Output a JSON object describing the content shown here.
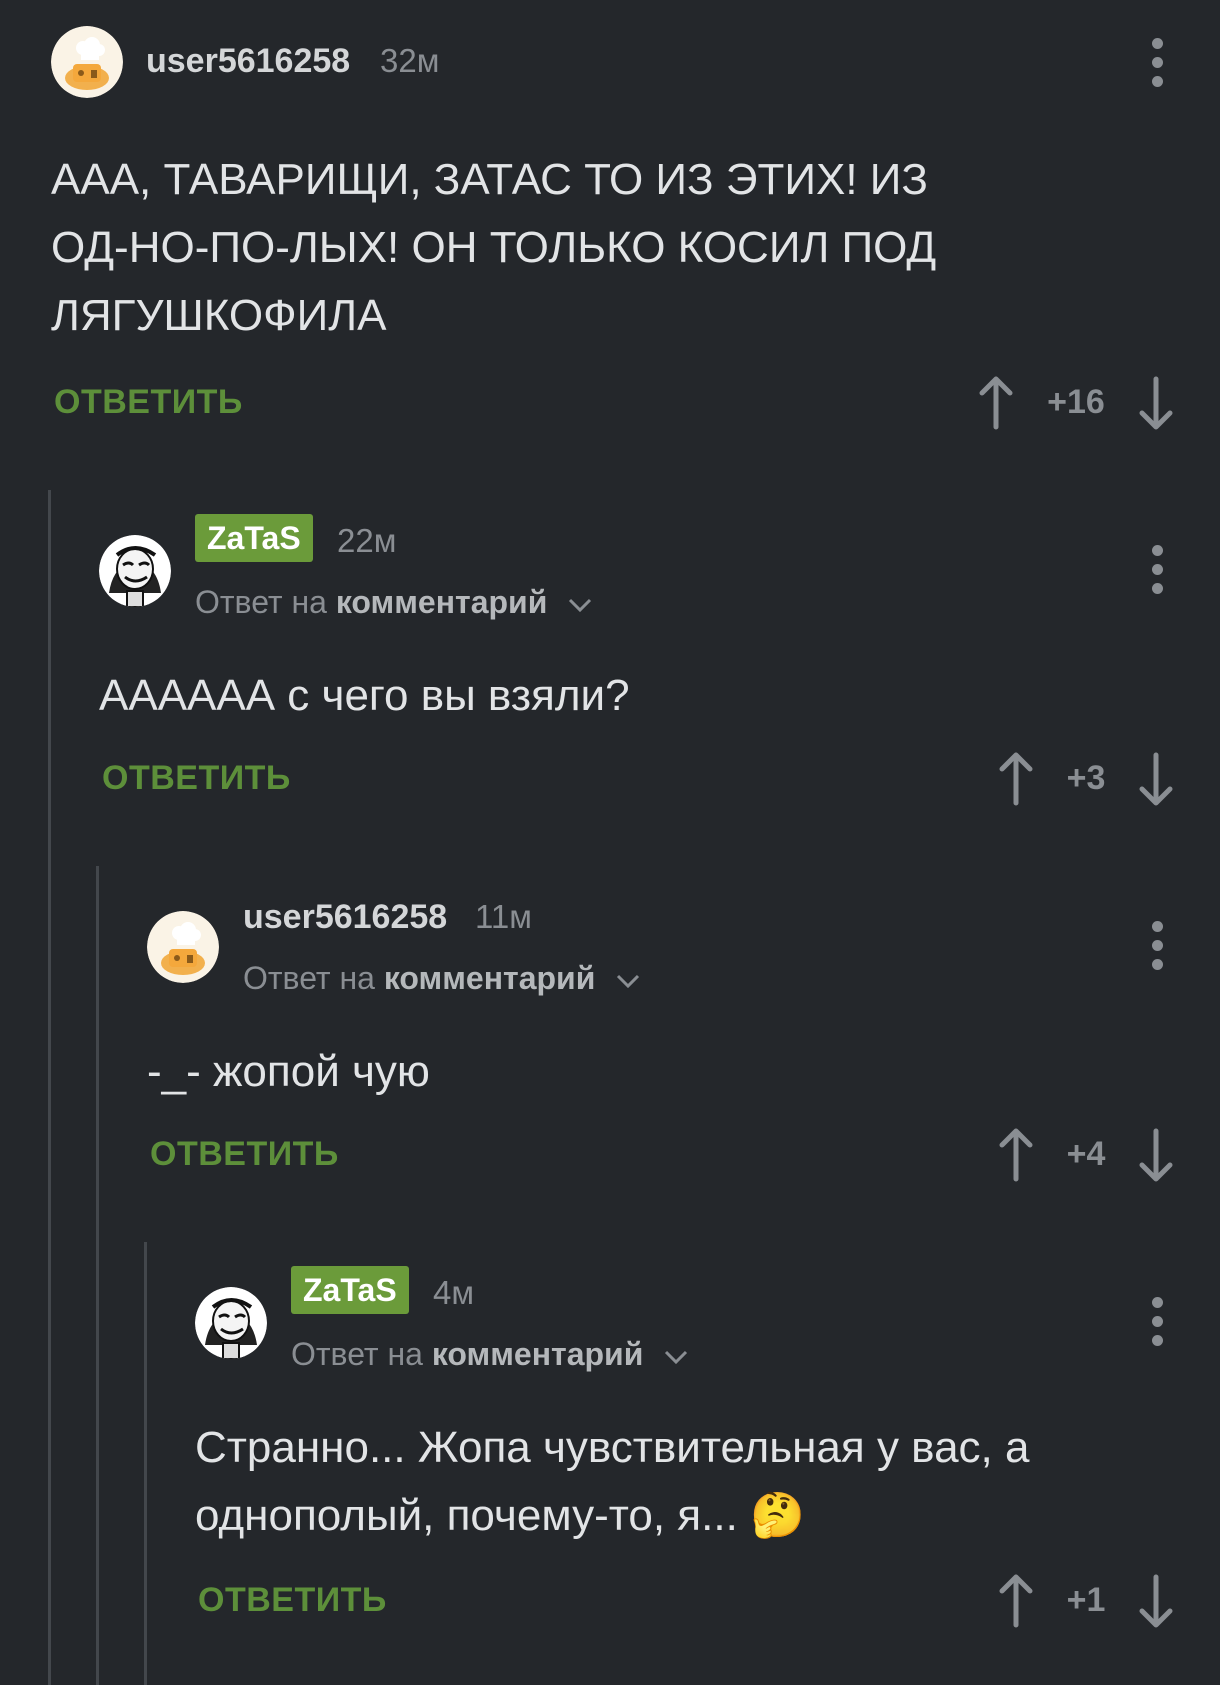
{
  "comments": [
    {
      "username": "user5616258",
      "time": "32м",
      "text": "ААА, ТАВАРИЩИ, ЗАТАС ТО ИЗ ЭТИХ! ИЗ\nОД-НО-ПО-ЛЫХ! ОН ТОЛЬКО КОСИЛ ПОД\nЛЯГУШКОФИЛА",
      "reply_label": "ОТВЕТИТЬ",
      "score": "+16"
    },
    {
      "username": "ZaTaS",
      "time": "22м",
      "reply_prefix": "Ответ на",
      "reply_target": "комментарий",
      "text": "АААААА с чего вы взяли?",
      "reply_label": "ОТВЕТИТЬ",
      "score": "+3"
    },
    {
      "username": "user5616258",
      "time": "11м",
      "reply_prefix": "Ответ на",
      "reply_target": "комментарий",
      "text": "-_- жопой чую",
      "reply_label": "ОТВЕТИТЬ",
      "score": "+4"
    },
    {
      "username": "ZaTaS",
      "time": "4м",
      "reply_prefix": "Ответ на",
      "reply_target": "комментарий",
      "text": "Странно... Жопа чувствительная у вас, а\nоднополый, почему-то, я... 🤔",
      "reply_label": "ОТВЕТИТЬ",
      "score": "+1"
    }
  ],
  "colors": {
    "background": "#24272b",
    "accent_green": "#5d8f3a",
    "badge_green": "#6b9b3a",
    "muted": "#8a8e93"
  },
  "icons": [
    "more-vertical-icon",
    "arrow-up-icon",
    "arrow-down-icon",
    "chevron-down-icon"
  ]
}
